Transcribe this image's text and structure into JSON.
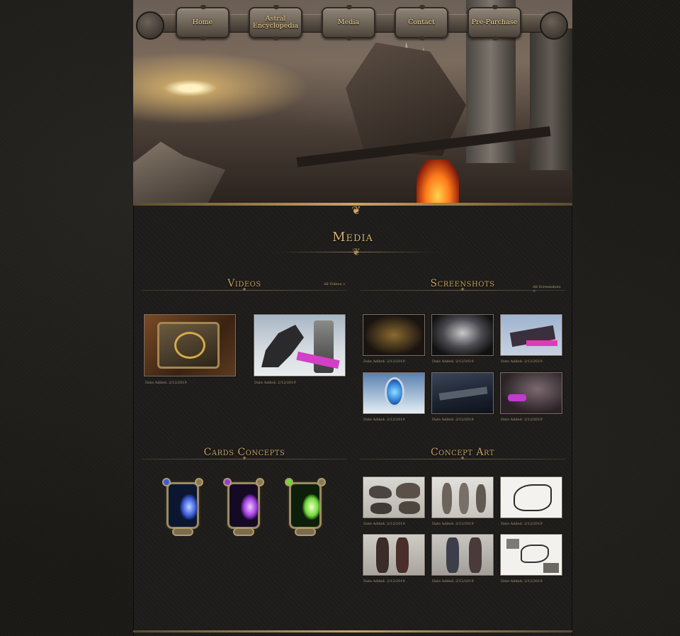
{
  "nav": {
    "items": [
      {
        "label": "Home"
      },
      {
        "label": "Astral Encyclopedia"
      },
      {
        "label": "Media"
      },
      {
        "label": "Contact"
      },
      {
        "label": "Pre-Purchase"
      }
    ]
  },
  "page": {
    "title": "Media"
  },
  "videos": {
    "heading": "Videos",
    "all_link": "All Videos >",
    "items": [
      {
        "date": "Date Added: 2/12/2019"
      },
      {
        "date": "Date Added: 2/12/2019"
      }
    ]
  },
  "screenshots": {
    "heading": "Screenshots",
    "all_link": "All Screenshots >",
    "items": [
      {
        "date": "Date Added: 2/12/2019"
      },
      {
        "date": "Date Added: 2/12/2019"
      },
      {
        "date": "Date Added: 2/12/2019"
      },
      {
        "date": "Date Added: 2/12/2019"
      },
      {
        "date": "Date Added: 2/12/2019"
      },
      {
        "date": "Date Added: 2/12/2019"
      }
    ]
  },
  "cards": {
    "heading": "Cards Concepts",
    "items": [
      {
        "color": "#3a5ad8"
      },
      {
        "color": "#9b3adb"
      },
      {
        "color": "#6fd83a"
      }
    ]
  },
  "concept_art": {
    "heading": "Concept Art",
    "items": [
      {
        "date": "Date Added: 2/12/2019"
      },
      {
        "date": "Date Added: 2/12/2019"
      },
      {
        "date": "Date Added: 2/12/2019"
      },
      {
        "date": "Date Added: 2/12/2019"
      },
      {
        "date": "Date Added: 2/12/2019"
      },
      {
        "date": "Date Added: 2/12/2019"
      }
    ]
  },
  "colors": {
    "accent_gold": "#c9a061",
    "background": "#1a1916"
  }
}
